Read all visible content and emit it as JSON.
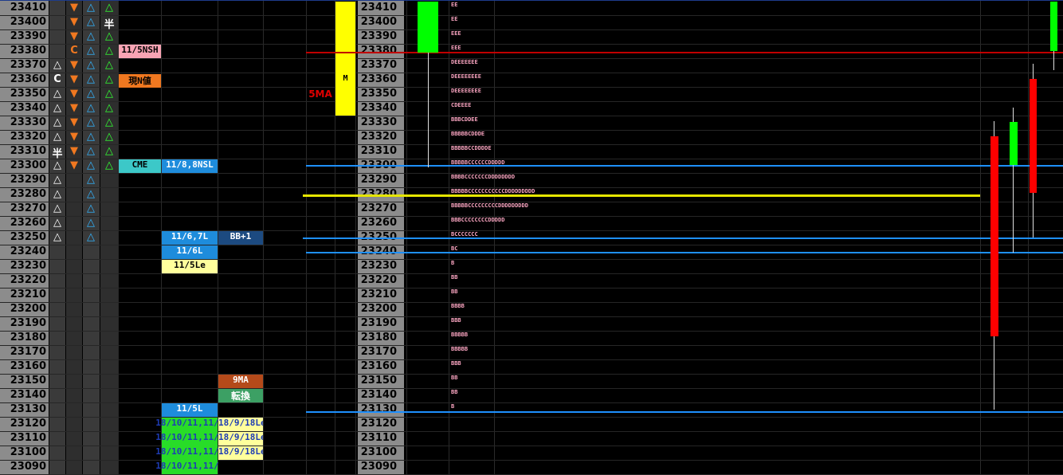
{
  "prices": [
    "23410",
    "23400",
    "23390",
    "23380",
    "23370",
    "23360",
    "23350",
    "23340",
    "23330",
    "23320",
    "23310",
    "23300",
    "23290",
    "23280",
    "23270",
    "23260",
    "23250",
    "23240",
    "23230",
    "23220",
    "23210",
    "23200",
    "23190",
    "23180",
    "23170",
    "23160",
    "23150",
    "23140",
    "23130",
    "23120",
    "23110",
    "23100",
    "23090"
  ],
  "col_a": [
    "",
    "",
    "",
    "",
    "△",
    "C",
    "△",
    "△",
    "△",
    "△",
    "半",
    "△",
    "△",
    "△",
    "△",
    "△",
    "△",
    "",
    "",
    "",
    "",
    "",
    "",
    "",
    "",
    "",
    "",
    "",
    "",
    "",
    "",
    "",
    ""
  ],
  "col_b": [
    "▼",
    "▼",
    "▼",
    "C",
    "▼",
    "▼",
    "▼",
    "▼",
    "▼",
    "▼",
    "▼",
    "▼",
    "",
    "",
    "",
    "",
    "",
    "",
    "",
    "",
    "",
    "",
    "",
    "",
    "",
    "",
    "",
    "",
    "",
    "",
    "",
    "",
    ""
  ],
  "col_c": [
    "△",
    "△",
    "△",
    "△",
    "△",
    "△",
    "△",
    "△",
    "△",
    "△",
    "△",
    "△",
    "△",
    "△",
    "△",
    "△",
    "△",
    "",
    "",
    "",
    "",
    "",
    "",
    "",
    "",
    "",
    "",
    "",
    "",
    "",
    "",
    "",
    ""
  ],
  "col_d": [
    "△",
    "半",
    "△",
    "△",
    "△",
    "△",
    "△",
    "△",
    "△",
    "△",
    "△",
    "△",
    "",
    "",
    "",
    "",
    "",
    "",
    "",
    "",
    "",
    "",
    "",
    "",
    "",
    "",
    "",
    "",
    "",
    "",
    "",
    "",
    ""
  ],
  "tags": {
    "nsh_115": "11/5NSH",
    "current": "現N値",
    "cme": "CME",
    "nsl_118": "11/8,8NSL",
    "l_116_7": "11/6,7L",
    "bb1": "BB+1",
    "l_116": "11/6L",
    "le_115": "11/5Le",
    "ma9": "9MA",
    "tenkan": "転換",
    "l_115": "11/5L",
    "green_row": "18/10/11,11/",
    "yellow_row": "18/9/18Le",
    "ma5": "5MA",
    "m": "M"
  },
  "tpo_rows": [
    "EE",
    "EE",
    "EEE",
    "EEE",
    "DEEEEEEE",
    "DEEEEEEEE",
    "DEEEEEEEE",
    "CDEEEE",
    "BBBCDDEE",
    "BBBBBCDDDE",
    "BBBBBCCDDDDE",
    "BBBBBCCCCCCDDDDD",
    "BBBBCCCCCCCDDDDDDDD",
    "BBBBBCCCCCCCCCCCDDDDDDDDD",
    "BBBBBCCCCCCCCCDDDDDDDDD",
    "BBBCCCCCCCCDDDDD",
    "BCCCCCCC",
    "BC",
    "B",
    "BB",
    "BB",
    "BBBB",
    "BBB",
    "BBBBB",
    "BBBBB",
    "BBB",
    "BB",
    "BB",
    "B",
    "",
    "",
    "",
    ""
  ],
  "colors": {
    "price_bg": "#8c8c8c",
    "down_arrow": "#f07820",
    "up_triangle_blue": "#32b4ff",
    "up_triangle_green": "#32ff32",
    "candle_up": "#00ff00",
    "candle_down": "#ff0000",
    "tpo_text": "#f9a4c0",
    "level_red": "#c00000",
    "level_blue": "#1e90ff",
    "level_yellow": "#e6e600"
  }
}
